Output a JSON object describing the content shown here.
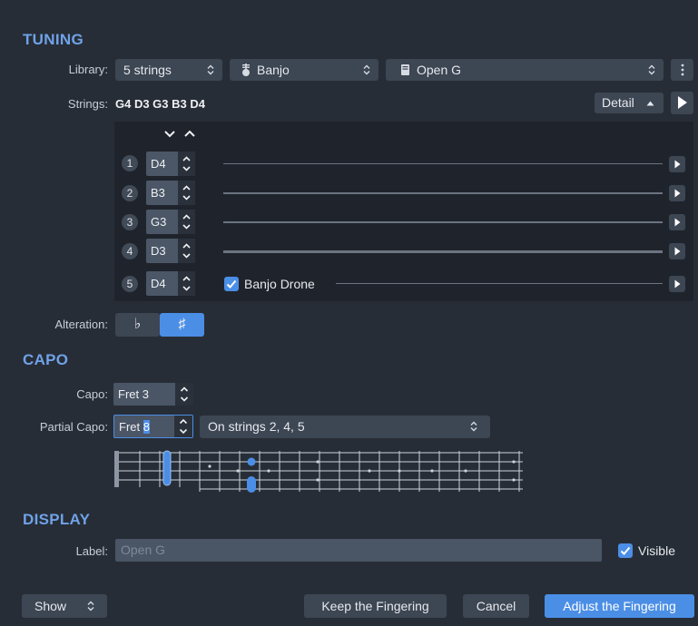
{
  "tuning": {
    "title": "TUNING",
    "library_label": "Library:",
    "strings_count": "5 strings",
    "instrument": "Banjo",
    "tuning_name": "Open G",
    "strings_label": "Strings:",
    "strings_value": "G4 D3 G3 B3 D4",
    "detail_label": "Detail",
    "rows": [
      {
        "num": "1",
        "note": "D4"
      },
      {
        "num": "2",
        "note": "B3"
      },
      {
        "num": "3",
        "note": "G3"
      },
      {
        "num": "4",
        "note": "D3"
      },
      {
        "num": "5",
        "note": "D4"
      }
    ],
    "banjo_drone_label": "Banjo Drone",
    "alteration_label": "Alteration:",
    "flat_symbol": "♭",
    "sharp_symbol": "♯"
  },
  "capo": {
    "title": "CAPO",
    "capo_label": "Capo:",
    "capo_value": "Fret 3",
    "partial_label": "Partial Capo:",
    "partial_prefix": "Fret ",
    "partial_fret": "8",
    "partial_strings": "On strings 2, 4, 5"
  },
  "display": {
    "title": "DISPLAY",
    "label_label": "Label:",
    "label_placeholder": "Open G",
    "visible_label": "Visible"
  },
  "footer": {
    "show_label": "Show",
    "keep_label": "Keep the Fingering",
    "cancel_label": "Cancel",
    "adjust_label": "Adjust the Fingering"
  },
  "colors": {
    "background": "#272d36",
    "accent": "#4b8ee6",
    "section_title": "#6fa2e8"
  }
}
